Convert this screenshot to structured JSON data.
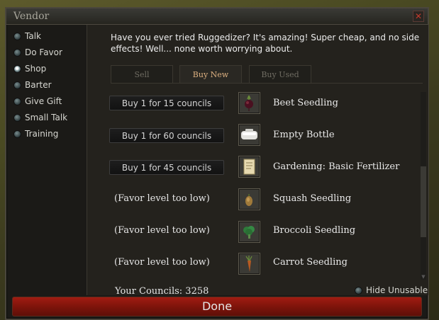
{
  "window": {
    "title": "Vendor",
    "close_glyph": "✕"
  },
  "sidebar": {
    "items": [
      {
        "label": "Talk",
        "selected": false
      },
      {
        "label": "Do Favor",
        "selected": false
      },
      {
        "label": "Shop",
        "selected": true
      },
      {
        "label": "Barter",
        "selected": false
      },
      {
        "label": "Give Gift",
        "selected": false
      },
      {
        "label": "Small Talk",
        "selected": false
      },
      {
        "label": "Training",
        "selected": false
      }
    ]
  },
  "intro_text": "Have you ever tried Ruggedizer? It's amazing! Super cheap, and no side effects! Well... none worth worrying about.",
  "tabs": [
    {
      "label": "Sell",
      "active": false
    },
    {
      "label": "Buy New",
      "active": true
    },
    {
      "label": "Buy Used",
      "active": false
    }
  ],
  "items": [
    {
      "action": "Buy 1 for 15 councils",
      "action_type": "button",
      "name": "Beet Seedling",
      "icon": "beet-icon"
    },
    {
      "action": "Buy 1 for 60 councils",
      "action_type": "button",
      "name": "Empty Bottle",
      "icon": "bottle-icon"
    },
    {
      "action": "Buy 1 for 45 councils",
      "action_type": "button",
      "name": "Gardening: Basic Fertilizer",
      "icon": "scroll-icon"
    },
    {
      "action": "(Favor level too low)",
      "action_type": "text",
      "name": "Squash Seedling",
      "icon": "squash-icon"
    },
    {
      "action": "(Favor level too low)",
      "action_type": "text",
      "name": "Broccoli Seedling",
      "icon": "broccoli-icon"
    },
    {
      "action": "(Favor level too low)",
      "action_type": "text",
      "name": "Carrot Seedling",
      "icon": "carrot-icon"
    }
  ],
  "footer": {
    "councils": "Your Councils: 3258",
    "hide_unusable": "Hide Unusable",
    "done": "Done"
  },
  "colors": {
    "accent_tab": "#dcb080",
    "done_button": "#8a170d",
    "panel": "#24221d"
  }
}
